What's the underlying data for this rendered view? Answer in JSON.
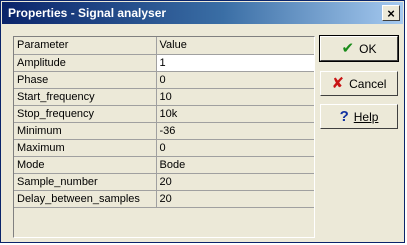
{
  "window": {
    "title": "Properties - Signal analyser",
    "close_glyph": "×"
  },
  "grid": {
    "columns": [
      "Parameter",
      "Value"
    ],
    "rows": [
      {
        "parameter": "Amplitude",
        "value": "1"
      },
      {
        "parameter": "Phase",
        "value": "0"
      },
      {
        "parameter": "Start_frequency",
        "value": "10"
      },
      {
        "parameter": "Stop_frequency",
        "value": "10k"
      },
      {
        "parameter": "Minimum",
        "value": "-36"
      },
      {
        "parameter": "Maximum",
        "value": "0"
      },
      {
        "parameter": "Mode",
        "value": "Bode"
      },
      {
        "parameter": "Sample_number",
        "value": "20"
      },
      {
        "parameter": "Delay_between_samples",
        "value": "20"
      }
    ],
    "selected_row": 0
  },
  "buttons": {
    "ok": {
      "label": "OK",
      "icon": "check-icon",
      "glyph": "✔"
    },
    "cancel": {
      "label": "Cancel",
      "icon": "cross-icon",
      "glyph": "✘"
    },
    "help": {
      "label": "Help",
      "icon": "help-icon",
      "glyph": "?"
    }
  },
  "colors": {
    "title_start": "#0a246a",
    "title_end": "#a6caf0",
    "face": "#ece9d8",
    "ok_icon": "#1a8c1a",
    "cancel_icon": "#c81414",
    "help_icon": "#1030a0"
  }
}
